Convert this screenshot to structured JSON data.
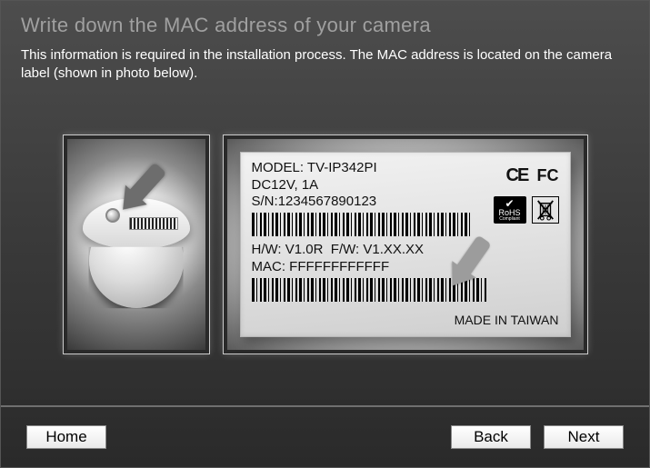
{
  "header": {
    "title": "Write down the MAC address of your camera",
    "instruction": "This information is required in the installation process. The MAC address is located on the camera label (shown in photo below)."
  },
  "label": {
    "model_prefix": "MODEL:",
    "model": "TV-IP342PI",
    "power": "DC12V, 1A",
    "serial_prefix": "S/N:",
    "serial": "1234567890123",
    "hw_prefix": "H/W:",
    "hw": "V1.0R",
    "fw_prefix": "F/W:",
    "fw": "V1.XX.XX",
    "mac_prefix": "MAC:",
    "mac": "FFFFFFFFFFFF",
    "origin": "MADE IN TAIWAN",
    "ce_mark": "CE",
    "fcc_mark": "FC",
    "rohs_label": "RoHS",
    "rohs_sub": "Compliant"
  },
  "footer": {
    "home": "Home",
    "back": "Back",
    "next": "Next"
  }
}
